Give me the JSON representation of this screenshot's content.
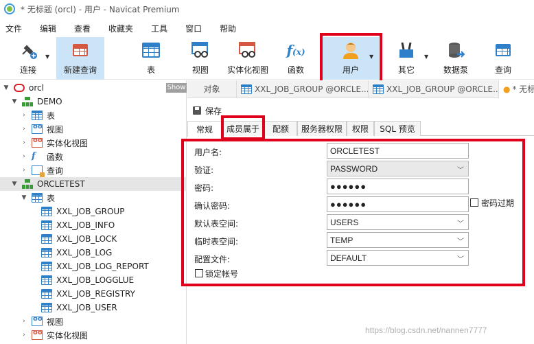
{
  "window": {
    "title": "* 无标题 (orcl) - 用户 - Navicat Premium"
  },
  "menu": [
    "文件",
    "编辑",
    "查看",
    "收藏夹",
    "工具",
    "窗口",
    "帮助"
  ],
  "toolbar": {
    "connect": "连接",
    "new_query": "新建查询",
    "table": "表",
    "view": "视图",
    "mview": "实体化视图",
    "function": "函数",
    "user": "用户",
    "other": "其它",
    "datasource": "数据泵",
    "query": "查询"
  },
  "sidebar": {
    "show_label": "Show",
    "connection": "orcl",
    "demo": {
      "name": "DEMO",
      "items": [
        "表",
        "视图",
        "实体化视图",
        "函数",
        "查询"
      ]
    },
    "orcletest": {
      "name": "ORCLETEST",
      "tables_label": "表",
      "tables": [
        "XXL_JOB_GROUP",
        "XXL_JOB_INFO",
        "XXL_JOB_LOCK",
        "XXL_JOB_LOG",
        "XXL_JOB_LOG_REPORT",
        "XXL_JOB_LOGGLUE",
        "XXL_JOB_REGISTRY",
        "XXL_JOB_USER"
      ],
      "views_label": "视图",
      "mviews_label": "实体化视图"
    }
  },
  "tabs": {
    "objects": "对象",
    "tab1": "XXL_JOB_GROUP @ORCLE...",
    "tab2": "XXL_JOB_GROUP @ORCLE...",
    "tab3": "* 无标"
  },
  "editor": {
    "save": "保存",
    "subtabs": [
      "常规",
      "成员属于",
      "配额",
      "服务器权限",
      "权限",
      "SQL 预览"
    ],
    "fields": {
      "username_label": "用户名:",
      "username": "ORCLETEST",
      "auth_label": "验证:",
      "auth": "PASSWORD",
      "password_label": "密码:",
      "password": "●●●●●●",
      "confirm_label": "确认密码:",
      "confirm": "●●●●●●",
      "expire_label": "密码过期",
      "default_ts_label": "默认表空间:",
      "default_ts": "USERS",
      "temp_ts_label": "临时表空间:",
      "temp_ts": "TEMP",
      "profile_label": "配置文件:",
      "profile": "DEFAULT",
      "lock_label": "锁定帐号"
    }
  },
  "watermark": "https://blog.csdn.net/nannen7777"
}
